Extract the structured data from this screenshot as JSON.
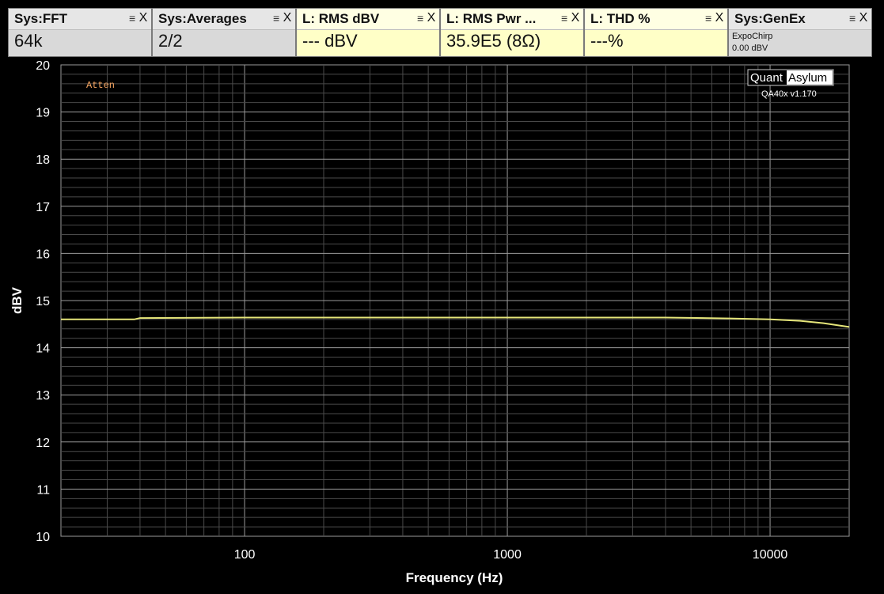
{
  "tiles": [
    {
      "title": "Sys:FFT",
      "value": "64k",
      "menu_icon": "menu-icon",
      "close_label": "X"
    },
    {
      "title": "Sys:Averages",
      "value": "2/2",
      "menu_icon": "menu-icon",
      "close_label": "X"
    },
    {
      "title": "L: RMS dBV",
      "value": "--- dBV",
      "menu_icon": "menu-icon",
      "close_label": "X"
    },
    {
      "title": "L: RMS Pwr ...",
      "value": "35.9E5 (8Ω)",
      "menu_icon": "menu-icon",
      "close_label": "X"
    },
    {
      "title": "L: THD %",
      "value": "---%",
      "menu_icon": "menu-icon",
      "close_label": "X"
    },
    {
      "title": "Sys:GenEx",
      "sub1": "ExpoChirp",
      "sub2": "0.00 dBV",
      "menu_icon": "menu-icon",
      "close_label": "X"
    }
  ],
  "colors": {
    "trace": "#e6e67a",
    "annotation": "#f4a460",
    "grid_major": "#9a9a9a",
    "grid_minor": "#4a4a4a"
  },
  "logo": {
    "left": "Quant",
    "right": "Asylum",
    "version": "QA40x v1.170"
  },
  "chart_data": {
    "type": "line",
    "xlabel": "Frequency (Hz)",
    "ylabel": "dBV",
    "xscale": "log",
    "xlim": [
      20,
      20000
    ],
    "ylim": [
      10,
      20
    ],
    "x_tick_labels": [
      "100",
      "1000",
      "10000"
    ],
    "y_tick_labels": [
      "10",
      "11",
      "12",
      "13",
      "14",
      "15",
      "16",
      "17",
      "18",
      "19",
      "20"
    ],
    "annotation": "Atten",
    "grid": true,
    "series": [
      {
        "x": [
          20,
          38,
          40,
          100,
          1000,
          4000,
          7000,
          10000,
          13000,
          16000,
          20000
        ],
        "y": [
          14.6,
          14.6,
          14.63,
          14.64,
          14.64,
          14.64,
          14.62,
          14.6,
          14.57,
          14.52,
          14.44
        ]
      }
    ]
  }
}
